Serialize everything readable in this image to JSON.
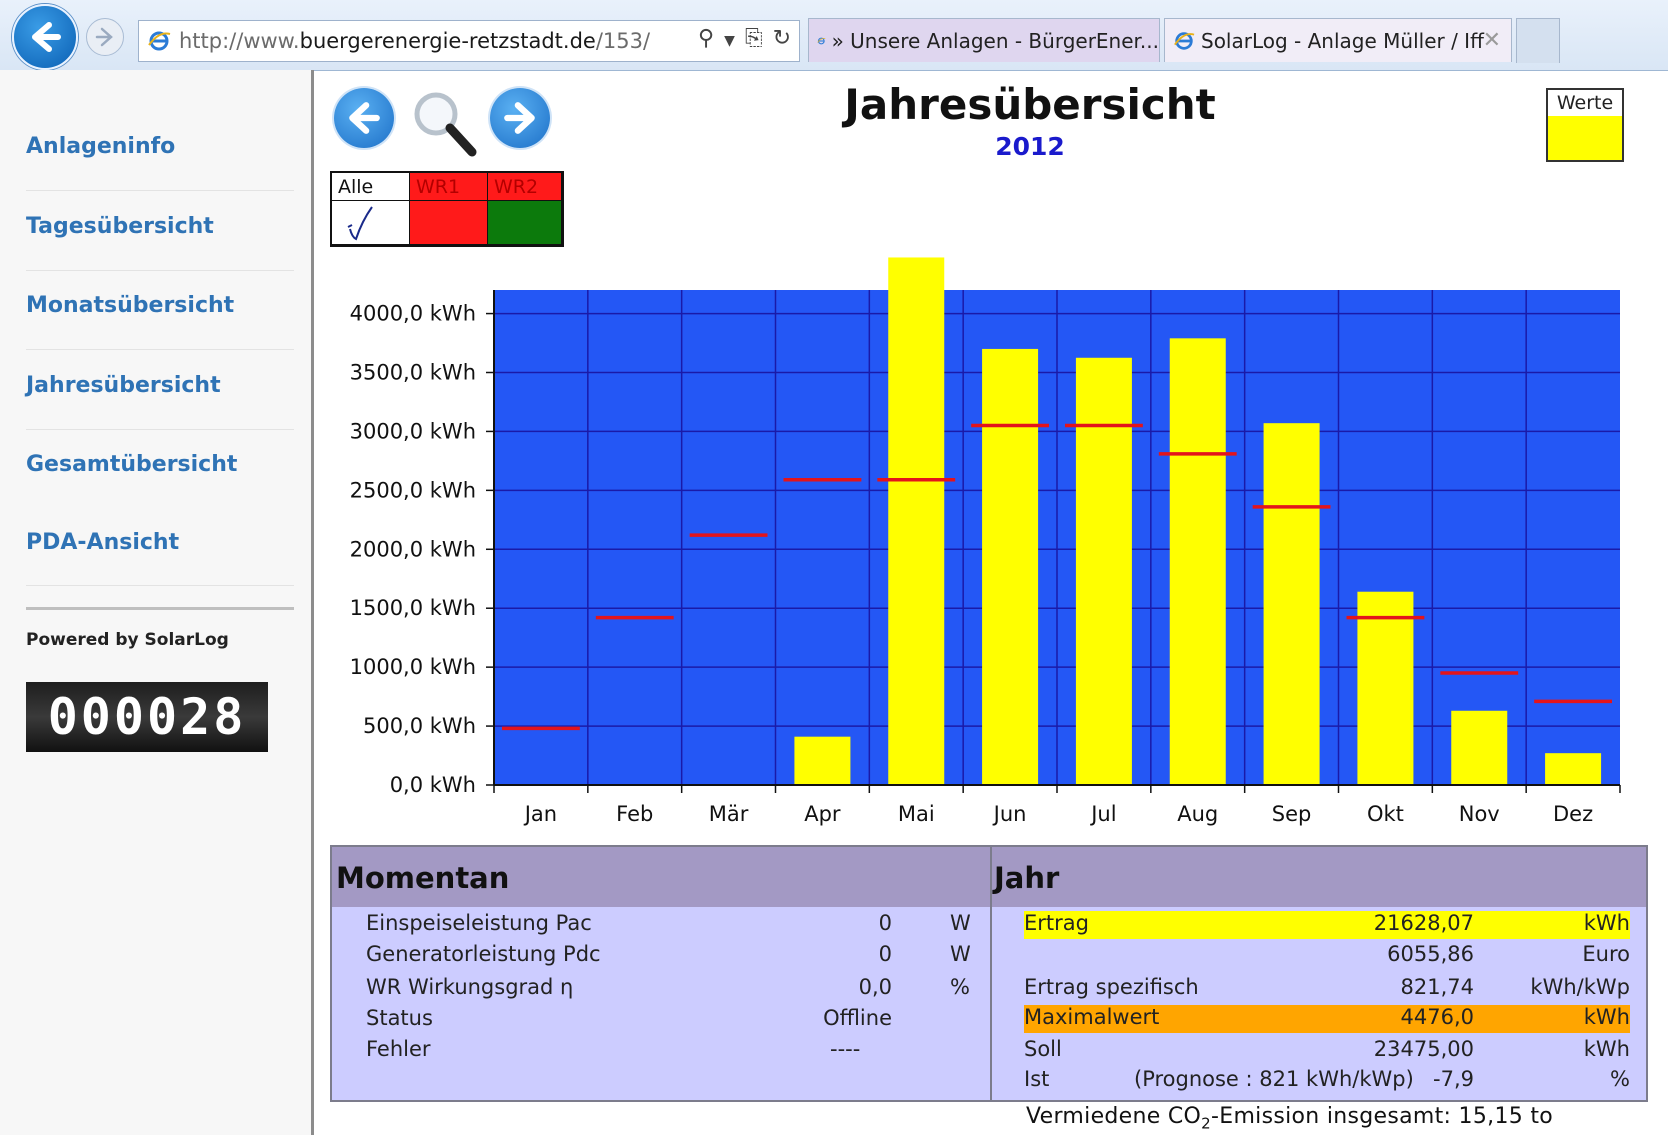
{
  "browser": {
    "url_prefix": "http://www.",
    "url_domain": "buergerenergie-retzstadt.de",
    "url_path": "/153/",
    "tabs": [
      {
        "label": "» Unsere Anlagen - BürgerEner..."
      },
      {
        "label": "SolarLog - Anlage Müller / Iff"
      }
    ]
  },
  "sidebar": {
    "items": [
      {
        "label": "Anlageninfo"
      },
      {
        "label": "Tagesübersicht"
      },
      {
        "label": "Monatsübersicht"
      },
      {
        "label": "Jahresübersicht"
      },
      {
        "label": "Gesamtübersicht"
      },
      {
        "label": "PDA-Ansicht"
      }
    ],
    "powered_by": "Powered by SolarLog",
    "visitor_counter": "000028"
  },
  "controls": {
    "wr_table": {
      "all_label": "Alle",
      "wr1_label": "WR1",
      "wr2_label": "WR2"
    },
    "wr1_color": "#ff1a1a",
    "wr2_color": "#0c7a0c"
  },
  "header": {
    "title": "Jahresübersicht",
    "year": "2012"
  },
  "legend": {
    "label": "Werte",
    "color": "#ffff00"
  },
  "chart_data": {
    "type": "bar",
    "categories": [
      "Jan",
      "Feb",
      "Mär",
      "Apr",
      "Mai",
      "Jun",
      "Jul",
      "Aug",
      "Sep",
      "Okt",
      "Nov",
      "Dez"
    ],
    "series": [
      {
        "name": "Werte",
        "values": [
          0,
          0,
          0,
          410,
          4476,
          3700,
          3625,
          3790,
          3070,
          1640,
          630,
          270
        ],
        "color": "#ffff00"
      }
    ],
    "target_values": [
      480,
      1420,
      2120,
      2590,
      2590,
      3050,
      3050,
      2810,
      2360,
      1420,
      950,
      710
    ],
    "target_color": "#e3141b",
    "y_ticks": [
      "0,0 kWh",
      "500,0 kWh",
      "1000,0 kWh",
      "1500,0 kWh",
      "2000,0 kWh",
      "2500,0 kWh",
      "3000,0 kWh",
      "3500,0 kWh",
      "4000,0 kWh"
    ],
    "ylim": [
      0,
      4200
    ],
    "background_color": "#2457f5",
    "grid_color": "#1a1aa8",
    "grid": true
  },
  "momentan": {
    "title": "Momentan",
    "rows": [
      {
        "label": "Einspeiseleistung Pac",
        "value": "0",
        "unit": "W"
      },
      {
        "label": "Generatorleistung Pdc",
        "value": "0",
        "unit": "W"
      },
      {
        "label": "WR Wirkungsgrad η",
        "value": "0,0",
        "unit": "%"
      },
      {
        "label": "Status",
        "value": "Offline",
        "unit": ""
      },
      {
        "label": "Fehler",
        "value": "----",
        "unit": ""
      }
    ]
  },
  "jahr": {
    "title": "Jahr",
    "ertrag": {
      "label": "Ertrag",
      "value": "21628,07",
      "unit": "kWh"
    },
    "euro": {
      "label": "",
      "value": "6055,86",
      "unit": "Euro"
    },
    "spezifisch": {
      "label": "Ertrag spezifisch",
      "value": "821,74",
      "unit": "kWh/kWp"
    },
    "maximal": {
      "label": "Maximalwert",
      "value": "4476,0",
      "unit": "kWh"
    },
    "soll": {
      "label": "Soll",
      "value": "23475,00",
      "unit": "kWh"
    },
    "ist": {
      "label": "Ist",
      "prognose": "(Prognose : 821 kWh/kWp)",
      "value": "-7,9",
      "unit": "%"
    }
  },
  "co2": {
    "prefix": "Vermiedene CO",
    "sub": "2",
    "suffix": "-Emission insgesamt: 15,15 to"
  }
}
